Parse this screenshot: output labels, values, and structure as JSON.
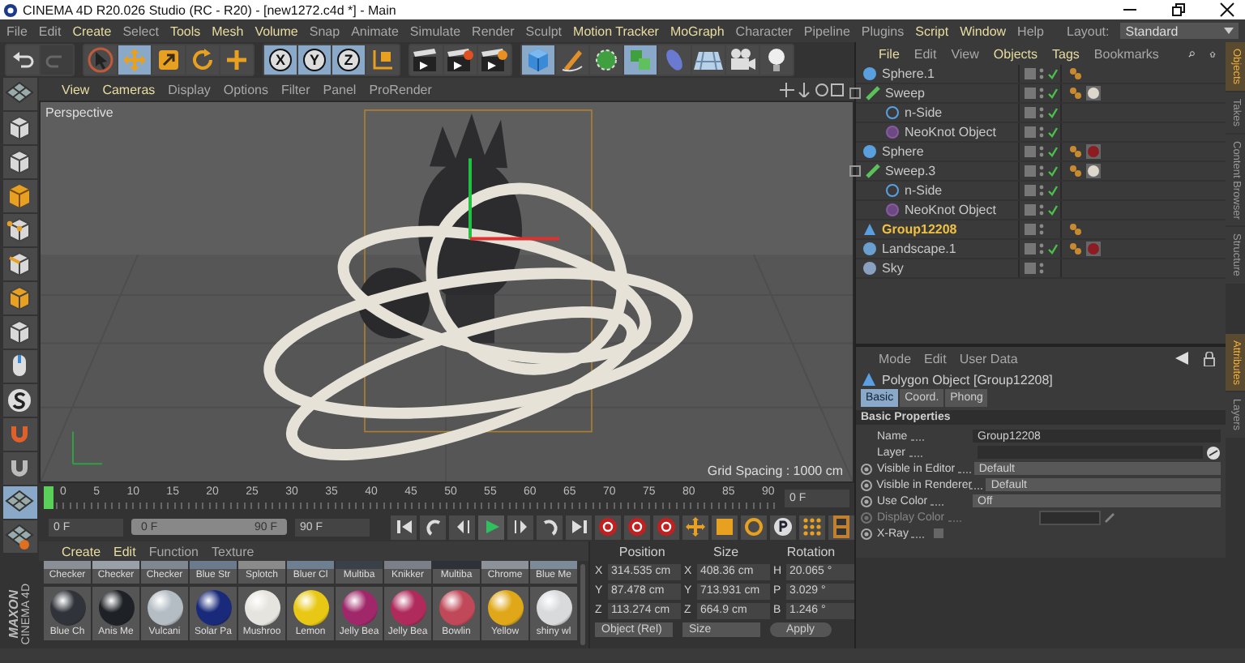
{
  "window": {
    "title": "CINEMA 4D R20.026 Studio (RC - R20) - [new1272.c4d *] - Main"
  },
  "menu": [
    {
      "label": "File",
      "emphasized": false
    },
    {
      "label": "Edit",
      "emphasized": false
    },
    {
      "label": "Create",
      "emphasized": true
    },
    {
      "label": "Select",
      "emphasized": false
    },
    {
      "label": "Tools",
      "emphasized": true
    },
    {
      "label": "Mesh",
      "emphasized": true
    },
    {
      "label": "Volume",
      "emphasized": true
    },
    {
      "label": "Snap",
      "emphasized": false
    },
    {
      "label": "Animate",
      "emphasized": false
    },
    {
      "label": "Simulate",
      "emphasized": false
    },
    {
      "label": "Render",
      "emphasized": false
    },
    {
      "label": "Sculpt",
      "emphasized": false
    },
    {
      "label": "Motion Tracker",
      "emphasized": true
    },
    {
      "label": "MoGraph",
      "emphasized": true
    },
    {
      "label": "Character",
      "emphasized": false
    },
    {
      "label": "Pipeline",
      "emphasized": false
    },
    {
      "label": "Plugins",
      "emphasized": false
    },
    {
      "label": "Script",
      "emphasized": true
    },
    {
      "label": "Window",
      "emphasized": true
    },
    {
      "label": "Help",
      "emphasized": false
    }
  ],
  "layout": {
    "label": "Layout:",
    "value": "Standard"
  },
  "toolbar": [
    {
      "kind": "undo",
      "selected": false,
      "disabled": false
    },
    {
      "kind": "redo",
      "selected": false,
      "disabled": true
    },
    {
      "kind": "live-select",
      "selected": false,
      "disabled": false
    },
    {
      "kind": "move",
      "selected": true,
      "disabled": false
    },
    {
      "kind": "scale",
      "selected": false,
      "disabled": false
    },
    {
      "kind": "rotate",
      "selected": false,
      "disabled": false
    },
    {
      "kind": "plus",
      "selected": false,
      "disabled": false
    },
    {
      "kind": "axis",
      "label": "X",
      "selected": true,
      "disabled": false
    },
    {
      "kind": "axis",
      "label": "Y",
      "selected": true,
      "disabled": false
    },
    {
      "kind": "axis",
      "label": "Z",
      "selected": true,
      "disabled": false
    },
    {
      "kind": "coordinates",
      "selected": false,
      "disabled": false
    },
    {
      "kind": "render-view",
      "selected": false,
      "disabled": false
    },
    {
      "kind": "render",
      "selected": false,
      "disabled": false
    },
    {
      "kind": "render-settings",
      "selected": false,
      "disabled": false
    },
    {
      "kind": "cube",
      "selected": true,
      "disabled": false
    },
    {
      "kind": "pen",
      "selected": false,
      "disabled": false
    },
    {
      "kind": "subdivision",
      "selected": false,
      "disabled": false
    },
    {
      "kind": "cloner",
      "selected": true,
      "disabled": false
    },
    {
      "kind": "deformer",
      "selected": false,
      "disabled": false
    },
    {
      "kind": "floor",
      "selected": false,
      "disabled": false
    },
    {
      "kind": "camera",
      "selected": false,
      "disabled": false
    },
    {
      "kind": "light",
      "selected": false,
      "disabled": false
    }
  ],
  "viewport": {
    "menu": [
      {
        "label": "View",
        "emphasized": true
      },
      {
        "label": "Cameras",
        "emphasized": true
      },
      {
        "label": "Display",
        "emphasized": false
      },
      {
        "label": "Options",
        "emphasized": false
      },
      {
        "label": "Filter",
        "emphasized": false
      },
      {
        "label": "Panel",
        "emphasized": false
      },
      {
        "label": "ProRender",
        "emphasized": false
      }
    ],
    "camera": "Perspective",
    "grid_spacing": "Grid Spacing : 1000 cm"
  },
  "left_toolbar": [
    {
      "kind": "make-editable",
      "selected": false
    },
    {
      "kind": "model",
      "selected": false
    },
    {
      "kind": "texture",
      "selected": false
    },
    {
      "kind": "axis-mode",
      "selected": false
    },
    {
      "kind": "points",
      "selected": false
    },
    {
      "kind": "edges",
      "selected": false
    },
    {
      "kind": "polygons",
      "selected": false
    },
    {
      "kind": "uv",
      "selected": false
    },
    {
      "kind": "mouse",
      "selected": false
    },
    {
      "kind": "solo",
      "selected": false
    },
    {
      "kind": "snap",
      "selected": false
    },
    {
      "kind": "magnet",
      "selected": false
    },
    {
      "kind": "workplane",
      "selected": true
    },
    {
      "kind": "workplane-lock",
      "selected": false
    }
  ],
  "logo": {
    "brand": "MAXON",
    "product": "CINEMA 4D"
  },
  "objects": {
    "menu": [
      {
        "label": "File",
        "emphasized": true
      },
      {
        "label": "Edit",
        "emphasized": false
      },
      {
        "label": "View",
        "emphasized": false
      },
      {
        "label": "Objects",
        "emphasized": true
      },
      {
        "label": "Tags",
        "emphasized": true
      },
      {
        "label": "Bookmarks",
        "emphasized": false
      }
    ],
    "items": [
      {
        "name": "Sphere.1",
        "kind": "sphere",
        "selected": false,
        "checked": true,
        "tags": [
          {
            "kind": "phong"
          }
        ]
      },
      {
        "name": "Sweep",
        "kind": "sweep",
        "selected": false,
        "checked": true,
        "expanded": true,
        "tags": [
          {
            "kind": "phong"
          },
          {
            "kind": "material",
            "color": "#dcd8cc"
          }
        ],
        "children": [
          {
            "name": "n-Side",
            "kind": "nside",
            "selected": false,
            "checked": true
          },
          {
            "name": "NeoKnot Object",
            "kind": "neoknot",
            "selected": false,
            "checked": true
          }
        ]
      },
      {
        "name": "Sphere",
        "kind": "sphere",
        "selected": false,
        "checked": true,
        "tags": [
          {
            "kind": "phong"
          },
          {
            "kind": "material",
            "color": "#8c1c22"
          }
        ]
      },
      {
        "name": "Sweep.3",
        "kind": "sweep",
        "selected": false,
        "checked": true,
        "expanded": true,
        "tags": [
          {
            "kind": "phong"
          },
          {
            "kind": "material",
            "color": "#dcd8cc"
          }
        ],
        "children": [
          {
            "name": "n-Side",
            "kind": "nside",
            "selected": false,
            "checked": true
          },
          {
            "name": "NeoKnot Object",
            "kind": "neoknot",
            "selected": false,
            "checked": true
          }
        ]
      },
      {
        "name": "Group12208",
        "kind": "polygon",
        "selected": true,
        "checked": false,
        "tags": [
          {
            "kind": "phong"
          }
        ]
      },
      {
        "name": "Landscape.1",
        "kind": "landscape",
        "selected": false,
        "checked": true,
        "tags": [
          {
            "kind": "phong"
          },
          {
            "kind": "material",
            "color": "#8c1c22"
          }
        ]
      },
      {
        "name": "Sky",
        "kind": "sky",
        "selected": false,
        "checked": false
      }
    ]
  },
  "attributes": {
    "menu": [
      {
        "label": "Mode",
        "emphasized": false
      },
      {
        "label": "Edit",
        "emphasized": false
      },
      {
        "label": "User Data",
        "emphasized": false
      }
    ],
    "object": "Polygon Object [Group12208]",
    "tabs": [
      {
        "label": "Basic",
        "selected": true
      },
      {
        "label": "Coord.",
        "selected": false
      },
      {
        "label": "Phong",
        "selected": false
      }
    ],
    "section": "Basic Properties",
    "fields": [
      {
        "label": "Name",
        "kind": "text",
        "value": "Group12208",
        "disabled": false
      },
      {
        "label": "Layer",
        "kind": "layer",
        "disabled": false
      },
      {
        "label": "Visible in Editor",
        "kind": "dropdown",
        "value": "Default",
        "disabled": false
      },
      {
        "label": "Visible in Renderer",
        "kind": "dropdown",
        "value": "Default",
        "disabled": false
      },
      {
        "label": "Use Color",
        "kind": "dropdown",
        "value": "Off",
        "disabled": false
      },
      {
        "label": "Display Color",
        "kind": "color",
        "disabled": true
      },
      {
        "label": "X-Ray",
        "kind": "checkbox",
        "checked": false,
        "disabled": false
      }
    ]
  },
  "side_tabs": [
    {
      "label": "Objects",
      "selected": true
    },
    {
      "label": "Takes",
      "selected": false
    },
    {
      "label": "Content Browser",
      "selected": false
    },
    {
      "label": "Structure",
      "selected": false
    }
  ],
  "side_tabs_lower": [
    {
      "label": "Attributes",
      "selected": true
    },
    {
      "label": "Layers",
      "selected": false
    }
  ],
  "timeline": {
    "ticks": [
      "0",
      "5",
      "10",
      "15",
      "20",
      "25",
      "30",
      "35",
      "40",
      "45",
      "50",
      "55",
      "60",
      "65",
      "70",
      "75",
      "80",
      "85",
      "90"
    ],
    "level": 0.0,
    "current": "0 F",
    "start": "0 F",
    "range": {
      "start": "0 F",
      "end": "90 F",
      "level": 1.0
    },
    "end": "90 F"
  },
  "transport": [
    {
      "kind": "first"
    },
    {
      "kind": "prev-key"
    },
    {
      "kind": "prev-frame"
    },
    {
      "kind": "play"
    },
    {
      "kind": "next-frame"
    },
    {
      "kind": "next-key"
    },
    {
      "kind": "last"
    },
    {
      "kind": "record"
    },
    {
      "kind": "autokey"
    },
    {
      "kind": "keyframe-selection"
    },
    {
      "kind": "key-position"
    },
    {
      "kind": "key-scale"
    },
    {
      "kind": "key-rotation"
    },
    {
      "kind": "key-parameter"
    },
    {
      "kind": "key-pla"
    },
    {
      "kind": "timeline"
    }
  ],
  "materials": {
    "menu": [
      {
        "label": "Create",
        "emphasized": true
      },
      {
        "label": "Edit",
        "emphasized": true
      },
      {
        "label": "Function",
        "emphasized": false
      },
      {
        "label": "Texture",
        "emphasized": false
      }
    ],
    "rows": [
      [
        {
          "name": "Checker",
          "color": "#8a8f96"
        },
        {
          "name": "Checker",
          "color": "#9aa0a8"
        },
        {
          "name": "Checker",
          "color": "#7f8790"
        },
        {
          "name": "Blue Str",
          "color": "#6b7a8c"
        },
        {
          "name": "Splotch",
          "color": "#8a8a8a"
        },
        {
          "name": "Bluer Cl",
          "color": "#6d7f90"
        },
        {
          "name": "Multiba",
          "color": "#3a4048"
        },
        {
          "name": "Knikker",
          "color": "#7b8088"
        },
        {
          "name": "Multiba",
          "color": "#2e3238"
        },
        {
          "name": "Chrome",
          "color": "#8d9299"
        },
        {
          "name": "Blue Me",
          "color": "#7d8a98"
        }
      ],
      [
        {
          "name": "Blue Ch",
          "color": "#30343a"
        },
        {
          "name": "Anis Me",
          "color": "#1e2226"
        },
        {
          "name": "Vulcani",
          "color": "#b4bcc4"
        },
        {
          "name": "Solar Pa",
          "color": "#1a2a7a"
        },
        {
          "name": "Mushroo",
          "color": "#e6e4de"
        },
        {
          "name": "Lemon",
          "color": "#e8c814"
        },
        {
          "name": "Jelly Bea",
          "color": "#a0286a"
        },
        {
          "name": "Jelly Bea",
          "color": "#b02a5c"
        },
        {
          "name": "Bowlin",
          "color": "#c04858"
        },
        {
          "name": "Yellow",
          "color": "#e0a818"
        },
        {
          "name": "shiny wl",
          "color": "#d8dadc"
        }
      ]
    ]
  },
  "coordinates": {
    "headers": [
      "Position",
      "Size",
      "Rotation"
    ],
    "rows": [
      [
        {
          "axis": "X",
          "value": "314.535 cm"
        },
        {
          "axis": "X",
          "value": "408.36 cm"
        },
        {
          "axis": "H",
          "value": "20.065 °"
        }
      ],
      [
        {
          "axis": "Y",
          "value": "87.478 cm"
        },
        {
          "axis": "Y",
          "value": "713.931 cm"
        },
        {
          "axis": "P",
          "value": "3.029 °"
        }
      ],
      [
        {
          "axis": "Z",
          "value": "113.274 cm"
        },
        {
          "axis": "Z",
          "value": "664.9 cm"
        },
        {
          "axis": "B",
          "value": "1.246 °"
        }
      ]
    ],
    "mode": "Object (Rel)",
    "size_mode": "Size",
    "apply": "Apply"
  }
}
